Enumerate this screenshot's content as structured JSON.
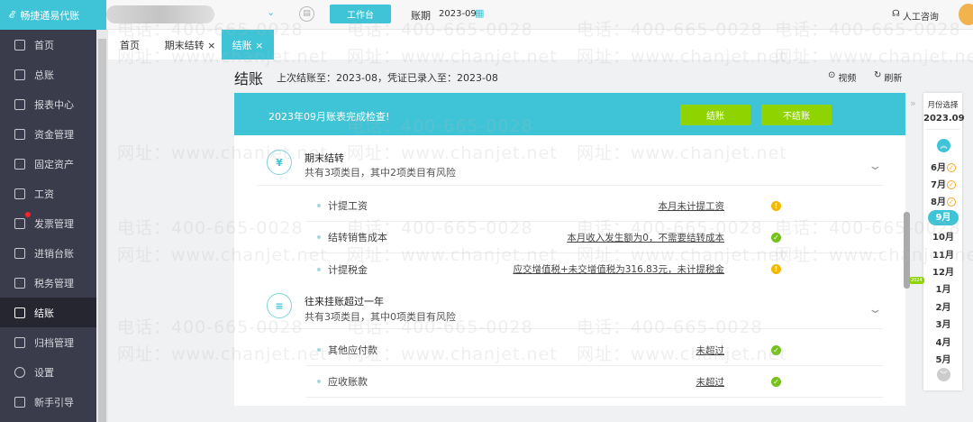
{
  "app": {
    "logo": "畅捷通易代账",
    "workbench": "工作台",
    "period_label": "账期",
    "period_value": "2023-09",
    "support": "人工咨询"
  },
  "sidebar": {
    "items": [
      {
        "label": "首页"
      },
      {
        "label": "总账"
      },
      {
        "label": "报表中心"
      },
      {
        "label": "资金管理"
      },
      {
        "label": "固定资产"
      },
      {
        "label": "工资"
      },
      {
        "label": "发票管理"
      },
      {
        "label": "进销台账"
      },
      {
        "label": "税务管理"
      },
      {
        "label": "结账"
      },
      {
        "label": "归档管理"
      },
      {
        "label": "设置"
      },
      {
        "label": "新手引导"
      }
    ]
  },
  "tabs": [
    {
      "label": "首页"
    },
    {
      "label": "期末结转 ×"
    },
    {
      "label": "结账 ×"
    }
  ],
  "page": {
    "title": "结账",
    "subtitle": "上次结账至：2023-08，凭证已录入至：2023-08",
    "video": "视频",
    "refresh": "刷新"
  },
  "banner": {
    "text": "2023年09月账表完成检查!",
    "close_btn": "结账",
    "no_close_btn": "不结账"
  },
  "sections": [
    {
      "icon": "¥",
      "title": "期末结转",
      "sub": "共有3项类目，其中2项类目有风险",
      "items": [
        {
          "label": "计提工资",
          "link": "本月未计提工资",
          "status": "warning"
        },
        {
          "label": "结转销售成本",
          "link": "本月收入发生额为0，不需要结转成本",
          "status": "ok"
        },
        {
          "label": "计提税金",
          "link": "应交增值税+未交增值税为316.83元，未计提税金",
          "status": "warning"
        }
      ]
    },
    {
      "icon": "≡",
      "title": "往来挂账超过一年",
      "sub": "共有3项类目，其中0项类目有风险",
      "items": [
        {
          "label": "其他应付款",
          "link": "未超过",
          "status": "ok"
        },
        {
          "label": "应收账款",
          "link": "未超过",
          "status": "ok"
        }
      ]
    }
  ],
  "month_panel": {
    "title": "月份选择",
    "current": "2023.09",
    "year_badge": "2024",
    "months": [
      "6月",
      "7月",
      "8月",
      "9月",
      "10月",
      "11月",
      "12月",
      "1月",
      "2月",
      "3月",
      "4月",
      "5月"
    ]
  },
  "watermark": {
    "phone": "电话：400-665-0028",
    "site": "网址：www.chanjet.net"
  },
  "colors": {
    "accent": "#3ec4d6",
    "green": "#8fd400",
    "sidebar": "#3b3c4b"
  }
}
